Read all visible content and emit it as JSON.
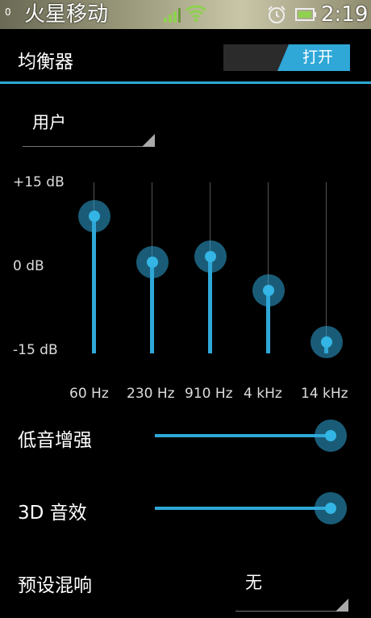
{
  "status_bar": {
    "notification_badge": "0",
    "carrier": "火星移动",
    "time": "2:19",
    "icons": [
      "signal-icon",
      "wifi-icon",
      "alarm-icon",
      "battery-icon"
    ]
  },
  "header": {
    "title": "均衡器",
    "toggle_label": "打开",
    "toggle_state": "on"
  },
  "preset": {
    "value": "用户"
  },
  "equalizer": {
    "db_labels": {
      "top": "+15 dB",
      "middle": "0 dB",
      "bottom": "-15 dB"
    },
    "range_db": [
      -15,
      15
    ],
    "bands": [
      {
        "freq": "60 Hz",
        "level_db": 9
      },
      {
        "freq": "230 Hz",
        "level_db": 1
      },
      {
        "freq": "910 Hz",
        "level_db": 2
      },
      {
        "freq": "4 kHz",
        "level_db": -4
      },
      {
        "freq": "14 kHz",
        "level_db": -13
      }
    ]
  },
  "effects": {
    "bass_boost": {
      "label": "低音增强",
      "level": 1.0
    },
    "virtualizer": {
      "label": "3D 音效",
      "level": 1.0
    },
    "reverb": {
      "label": "预设混响",
      "value": "无"
    }
  },
  "colors": {
    "accent": "#33b5e5",
    "background": "#000000"
  }
}
